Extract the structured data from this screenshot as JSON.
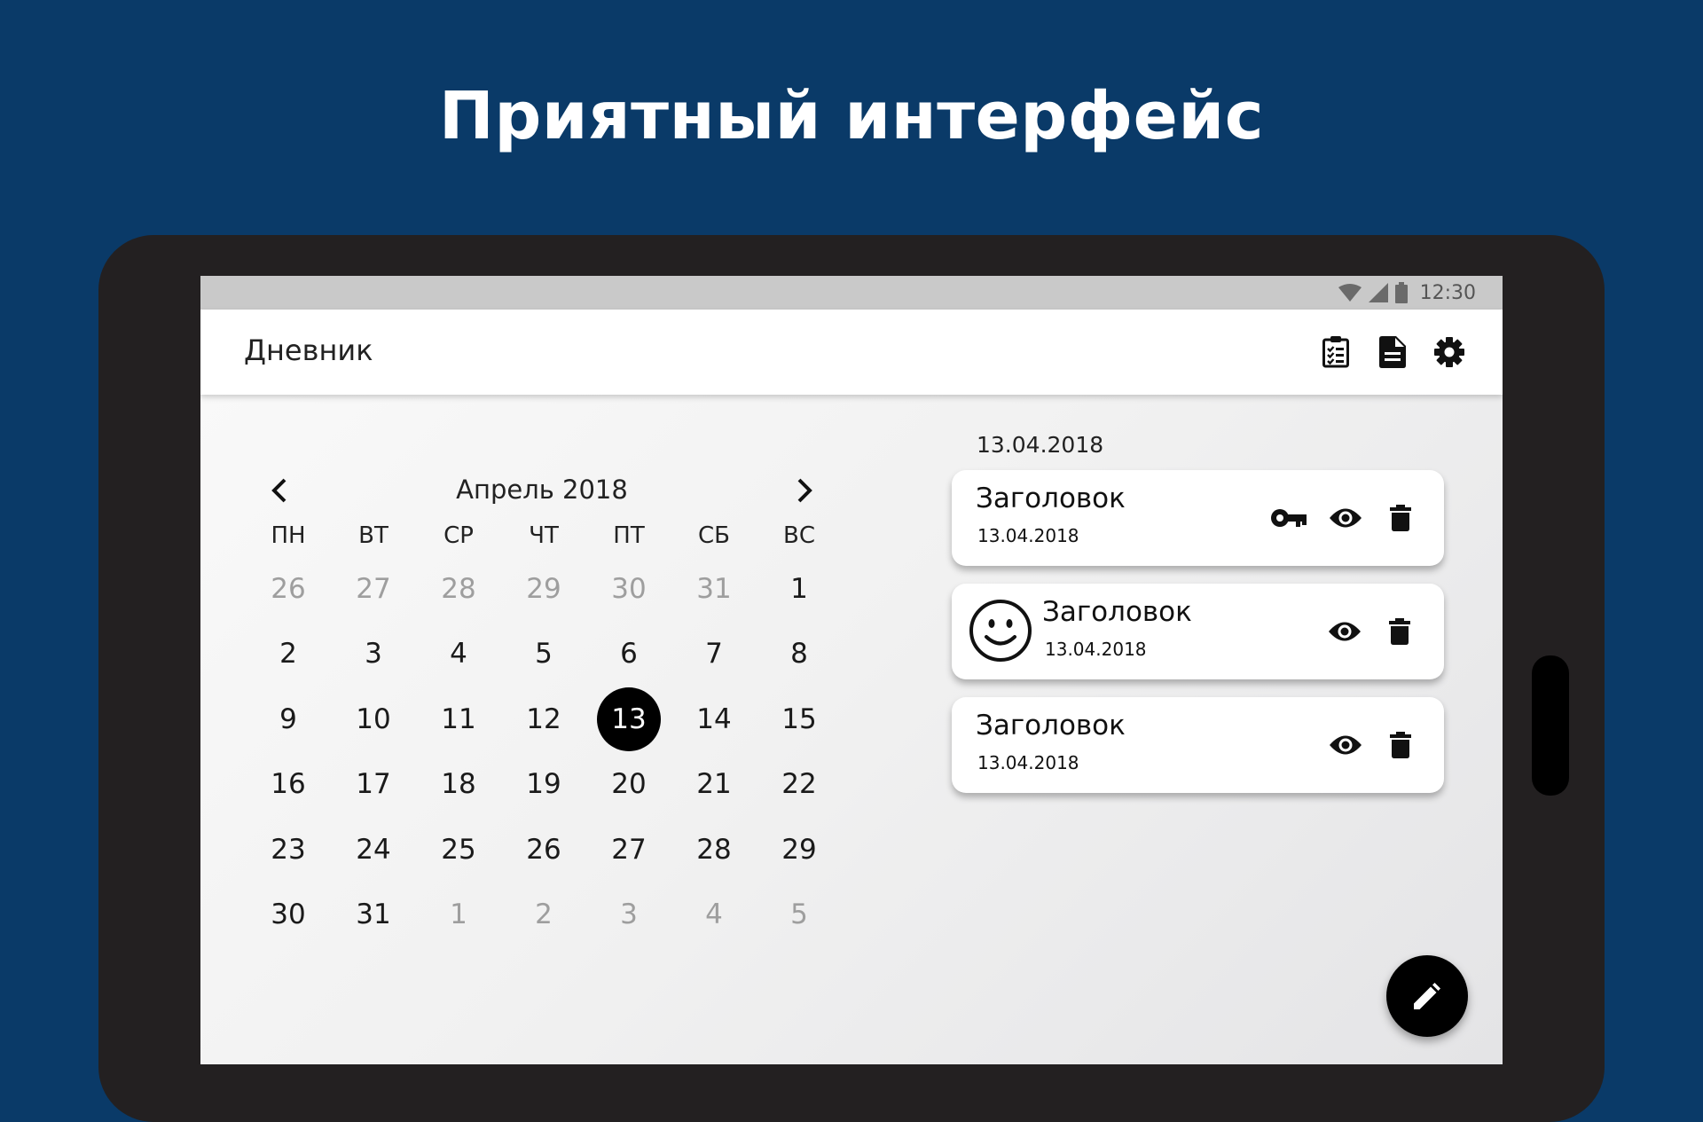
{
  "headline": "Приятный интерфейс",
  "status_bar": {
    "time": "12:30",
    "icons": [
      "wifi-icon",
      "signal-icon",
      "battery-icon"
    ]
  },
  "app_bar": {
    "title": "Дневник",
    "actions": [
      "checklist-icon",
      "document-icon",
      "settings-icon"
    ]
  },
  "calendar": {
    "month_label": "Апрель 2018",
    "weekdays": [
      "ПН",
      "ВТ",
      "СР",
      "ЧТ",
      "ПТ",
      "СБ",
      "ВС"
    ],
    "weeks": [
      [
        "26",
        "27",
        "28",
        "29",
        "30",
        "31",
        "1"
      ],
      [
        "2",
        "3",
        "4",
        "5",
        "6",
        "7",
        "8"
      ],
      [
        "9",
        "10",
        "11",
        "12",
        "13",
        "14",
        "15"
      ],
      [
        "16",
        "17",
        "18",
        "19",
        "20",
        "21",
        "22"
      ],
      [
        "23",
        "24",
        "25",
        "26",
        "27",
        "28",
        "29"
      ],
      [
        "30",
        "31",
        "1",
        "2",
        "3",
        "4",
        "5"
      ]
    ],
    "selected_day": "13"
  },
  "entries": {
    "date_heading": "13.04.2018",
    "items": [
      {
        "title": "Заголовок",
        "date": "13.04.2018",
        "has_key": true,
        "has_mood": false
      },
      {
        "title": "Заголовок",
        "date": "13.04.2018",
        "has_key": false,
        "has_mood": true
      },
      {
        "title": "Заголовок",
        "date": "13.04.2018",
        "has_key": false,
        "has_mood": false
      }
    ]
  },
  "fab": {
    "icon": "pencil-icon"
  },
  "colors": {
    "page_bg": "#0a3a68",
    "tablet_frame": "#232021",
    "selected_day": "#000000"
  }
}
